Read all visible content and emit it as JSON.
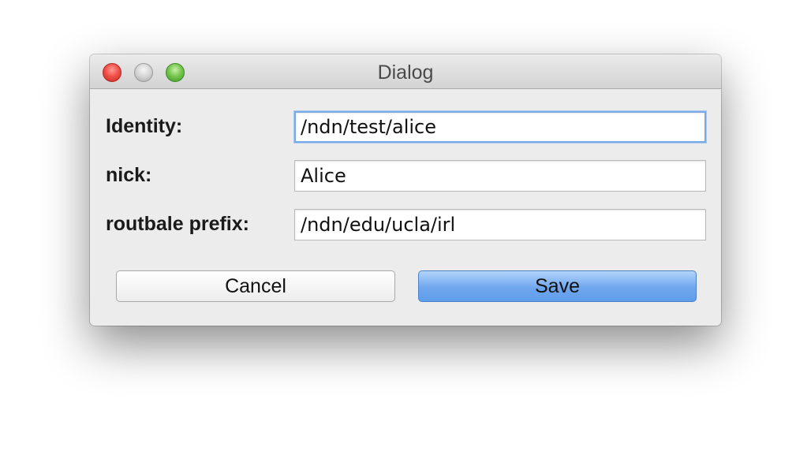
{
  "window": {
    "title": "Dialog"
  },
  "form": {
    "identity": {
      "label": "Identity:",
      "value": "/ndn/test/alice"
    },
    "nick": {
      "label": "nick:",
      "value": "Alice"
    },
    "prefix": {
      "label": "routbale prefix:",
      "value": "/ndn/edu/ucla/irl"
    }
  },
  "buttons": {
    "cancel_label": "Cancel",
    "save_label": "Save"
  },
  "colors": {
    "accent": "#6fa7ee",
    "close": "#f0524a",
    "zoom": "#78c650"
  },
  "icons": {
    "close": "close-icon",
    "minimize": "minimize-icon",
    "zoom": "zoom-icon"
  }
}
